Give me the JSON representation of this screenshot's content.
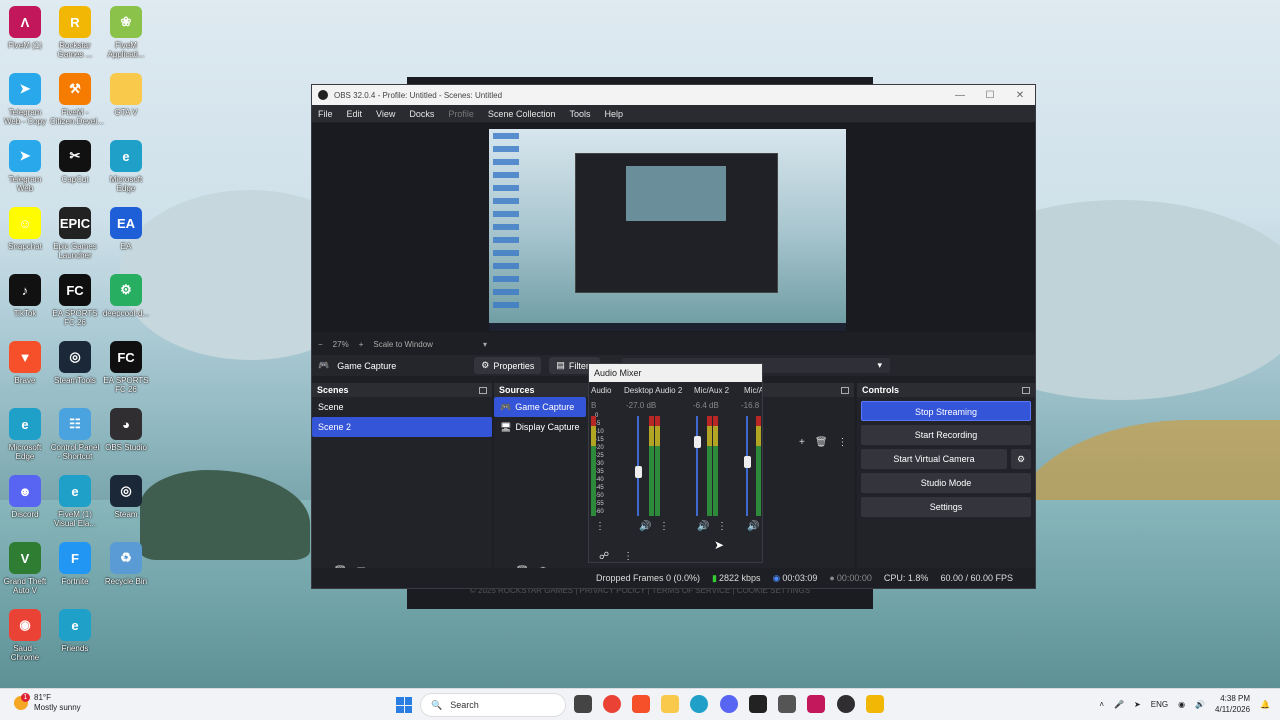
{
  "desktop": {
    "icons": [
      {
        "label": "FiveM (1)",
        "icon": "fivem-icon",
        "color": "#c2185b",
        "glyph": "Λ"
      },
      {
        "label": "Rockstar Games ...",
        "icon": "rockstar-icon",
        "color": "#f2b705",
        "glyph": "R"
      },
      {
        "label": "FiveM Applicati...",
        "icon": "folder-snail-icon",
        "color": "#8bc34a",
        "glyph": "❀"
      },
      {
        "label": "Telegram Web - Copy",
        "icon": "telegram-icon",
        "color": "#29a9eb",
        "glyph": "➤"
      },
      {
        "label": "FiveM - Citizen.Devel...",
        "icon": "fivem-dev-icon",
        "color": "#f57c00",
        "glyph": "⚒"
      },
      {
        "label": "GTA V",
        "icon": "folder-icon",
        "color": "#f8c94a",
        "glyph": ""
      },
      {
        "label": "Telegram Web",
        "icon": "telegram-icon",
        "color": "#29a9eb",
        "glyph": "➤"
      },
      {
        "label": "CapCut",
        "icon": "capcut-icon",
        "color": "#111111",
        "glyph": "✂"
      },
      {
        "label": "Microsoft Edge",
        "icon": "edge-icon",
        "color": "#1fa0c9",
        "glyph": "e"
      },
      {
        "label": "Snapchat",
        "icon": "snapchat-icon",
        "color": "#fffc00",
        "glyph": "☺"
      },
      {
        "label": "Epic Games Launcher",
        "icon": "epic-icon",
        "color": "#222222",
        "glyph": "EPIC"
      },
      {
        "label": "EA",
        "icon": "ea-icon",
        "color": "#1e5fd8",
        "glyph": "EA"
      },
      {
        "label": "TikTok",
        "icon": "tiktok-icon",
        "color": "#111111",
        "glyph": "♪"
      },
      {
        "label": "EA SPORTS FC 26",
        "icon": "fc26-icon",
        "color": "#0f0f0f",
        "glyph": "FC"
      },
      {
        "label": "deepcool-d...",
        "icon": "deepcool-icon",
        "color": "#27ae60",
        "glyph": "⚙"
      },
      {
        "label": "Brave",
        "icon": "brave-icon",
        "color": "#f5502a",
        "glyph": "▼"
      },
      {
        "label": "SteamTools",
        "icon": "steamtools-icon",
        "color": "#1b2838",
        "glyph": "◎"
      },
      {
        "label": "EA SPORTS FC 26",
        "icon": "fc26-icon",
        "color": "#0f0f0f",
        "glyph": "FC"
      },
      {
        "label": "Microsoft Edge",
        "icon": "edge-icon",
        "color": "#1fa0c9",
        "glyph": "e"
      },
      {
        "label": "Control Panel - Shortcut",
        "icon": "control-panel-icon",
        "color": "#4aa3df",
        "glyph": "☷"
      },
      {
        "label": "OBS Studio",
        "icon": "obs-icon",
        "color": "#302e31",
        "glyph": "◕"
      },
      {
        "label": "Discord",
        "icon": "discord-icon",
        "color": "#5865f2",
        "glyph": "☻"
      },
      {
        "label": "FiveM (1) Visual Ela...",
        "icon": "edge-icon",
        "color": "#1fa0c9",
        "glyph": "e"
      },
      {
        "label": "Steam",
        "icon": "steam-icon",
        "color": "#1b2838",
        "glyph": "◎"
      },
      {
        "label": "Grand Theft Auto V",
        "icon": "gta-icon",
        "color": "#2e7d32",
        "glyph": "V"
      },
      {
        "label": "Fortnite",
        "icon": "fortnite-icon",
        "color": "#2196f3",
        "glyph": "F"
      },
      {
        "label": "Recycle Bin",
        "icon": "recycle-bin-icon",
        "color": "#5b9bd5",
        "glyph": "♻"
      },
      {
        "label": "Saud - Chrome",
        "icon": "chrome-icon",
        "color": "#ea4335",
        "glyph": "◉"
      },
      {
        "label": "Friends",
        "icon": "edge-icon",
        "color": "#1fa0c9",
        "glyph": "e"
      }
    ]
  },
  "back_window": {
    "footer": "© 2025 ROCKSTAR GAMES | PRIVACY POLICY | TERMS OF SERVICE | COOKIE SETTINGS"
  },
  "obs": {
    "title": "OBS 32.0.4 - Profile: Untitled - Scenes: Untitled",
    "menu": [
      "File",
      "Edit",
      "View",
      "Docks",
      "Profile",
      "Scene Collection",
      "Tools",
      "Help"
    ],
    "zoom": {
      "minus": "−",
      "value": "27%",
      "plus": "+",
      "mode": "Scale to Window"
    },
    "context": {
      "source": "Game Capture",
      "properties": "Properties",
      "filters": "Filters"
    },
    "scenes": {
      "title": "Scenes",
      "items": [
        "Scene",
        "Scene 2"
      ],
      "selected": 1
    },
    "sources": {
      "title": "Sources",
      "items": [
        "Game Capture",
        "Display Capture"
      ],
      "selected": 0
    },
    "controls": {
      "title": "Controls",
      "stop_streaming": "Stop Streaming",
      "start_recording": "Start Recording",
      "start_virtual_camera": "Start Virtual Camera",
      "studio_mode": "Studio Mode",
      "settings": "Settings"
    },
    "mixer": {
      "title": "Audio Mixer",
      "channels": [
        {
          "name": "Audio",
          "db": "B"
        },
        {
          "name": "Desktop Audio 2",
          "db": "-27.0 dB",
          "level": 0.3
        },
        {
          "name": "Mic/Aux 2",
          "db": "-6.4 dB",
          "level": 0.7
        },
        {
          "name": "Mic/A",
          "db": "-16.8",
          "level": 0.5
        }
      ],
      "scale": [
        "0",
        "-5",
        "-10",
        "-15",
        "-20",
        "-25",
        "-30",
        "-35",
        "-40",
        "-45",
        "-50",
        "-55",
        "-60"
      ]
    },
    "status": {
      "dropped": "Dropped Frames 0 (0.0%)",
      "bitrate": "2822 kbps",
      "stream_time": "00:03:09",
      "rec_time": "00:00:00",
      "cpu": "CPU: 1.8%",
      "fps": "60.00 / 60.00 FPS"
    }
  },
  "taskbar": {
    "weather_temp": "81°F",
    "weather_desc": "Mostly sunny",
    "weather_badge": "1",
    "search": "Search",
    "language": "ENG",
    "time": "4:38 PM",
    "date": "4/11/2026"
  }
}
